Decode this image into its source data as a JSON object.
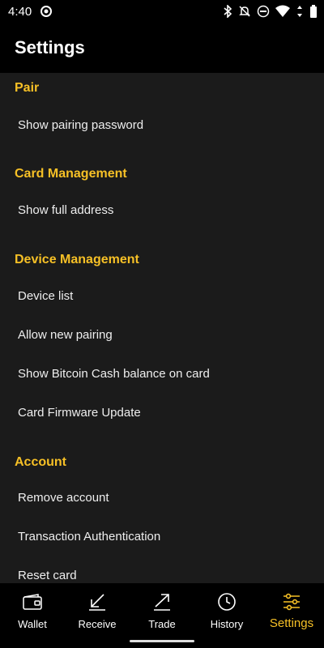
{
  "status_bar": {
    "time": "4:40",
    "icons": [
      "circle-app-icon",
      "bluetooth-icon",
      "mute-icon",
      "dnd-icon",
      "wifi-icon",
      "battery-icon"
    ]
  },
  "app_bar": {
    "title": "Settings"
  },
  "sections": {
    "pair": {
      "title": "Pair",
      "items": [
        "Show pairing password"
      ]
    },
    "card_management": {
      "title": "Card Management",
      "items": [
        "Show full address"
      ]
    },
    "device_management": {
      "title": "Device Management",
      "items": [
        "Device list",
        "Allow new pairing",
        "Show Bitcoin Cash balance on card",
        "Card Firmware Update"
      ]
    },
    "account": {
      "title": "Account",
      "items": [
        "Remove account",
        "Transaction Authentication",
        "Reset card"
      ]
    }
  },
  "bottom_nav": {
    "items": [
      {
        "label": "Wallet",
        "icon": "wallet-icon"
      },
      {
        "label": "Receive",
        "icon": "receive-arrow-icon"
      },
      {
        "label": "Trade",
        "icon": "trade-arrow-icon"
      },
      {
        "label": "History",
        "icon": "clock-icon"
      },
      {
        "label": "Settings",
        "icon": "sliders-icon"
      }
    ],
    "active": "Settings"
  },
  "colors": {
    "accent": "#f6c026",
    "background": "#1b1b1b",
    "bar": "#000000"
  }
}
